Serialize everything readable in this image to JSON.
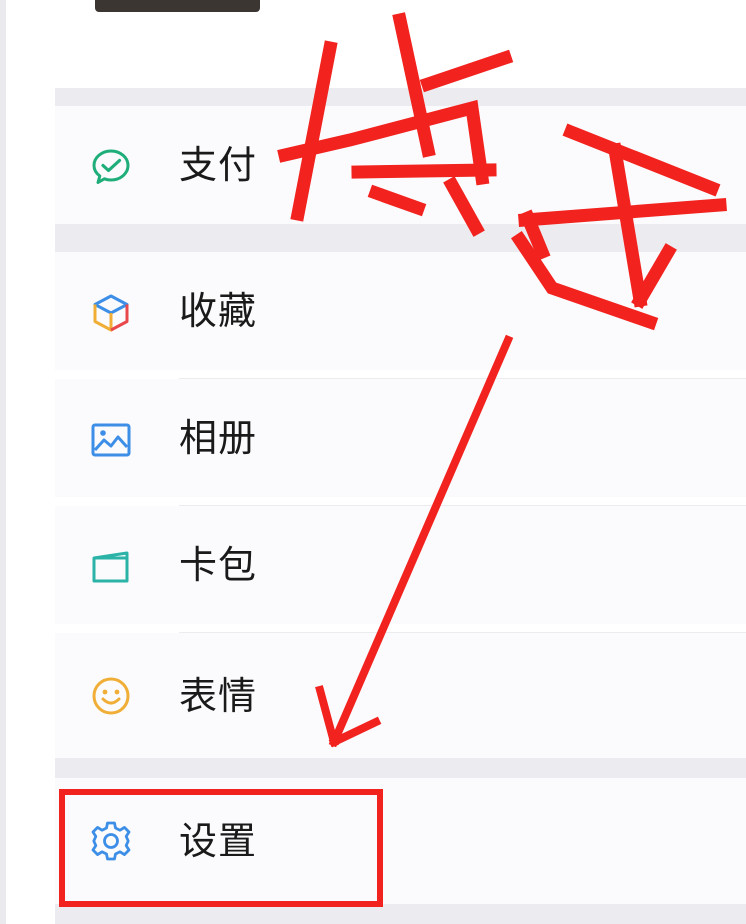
{
  "menu": {
    "items": [
      {
        "key": "pay",
        "label": "支付",
        "icon": "wechat-pay-icon"
      },
      {
        "key": "favorites",
        "label": "收藏",
        "icon": "cube-icon"
      },
      {
        "key": "album",
        "label": "相册",
        "icon": "image-icon"
      },
      {
        "key": "cards",
        "label": "卡包",
        "icon": "wallet-icon"
      },
      {
        "key": "sticker",
        "label": "表情",
        "icon": "smiley-icon"
      },
      {
        "key": "settings",
        "label": "设置",
        "icon": "gear-icon"
      }
    ]
  },
  "annotation": {
    "text": "点击",
    "color": "#f2231f",
    "target": "settings"
  },
  "colors": {
    "row_bg": "#fbfbfd",
    "section_gap": "#ececf0",
    "icon_green": "#1fae7a",
    "icon_blue": "#3d8ee6",
    "icon_teal": "#2bb3a8",
    "icon_amber": "#f0ae37"
  }
}
